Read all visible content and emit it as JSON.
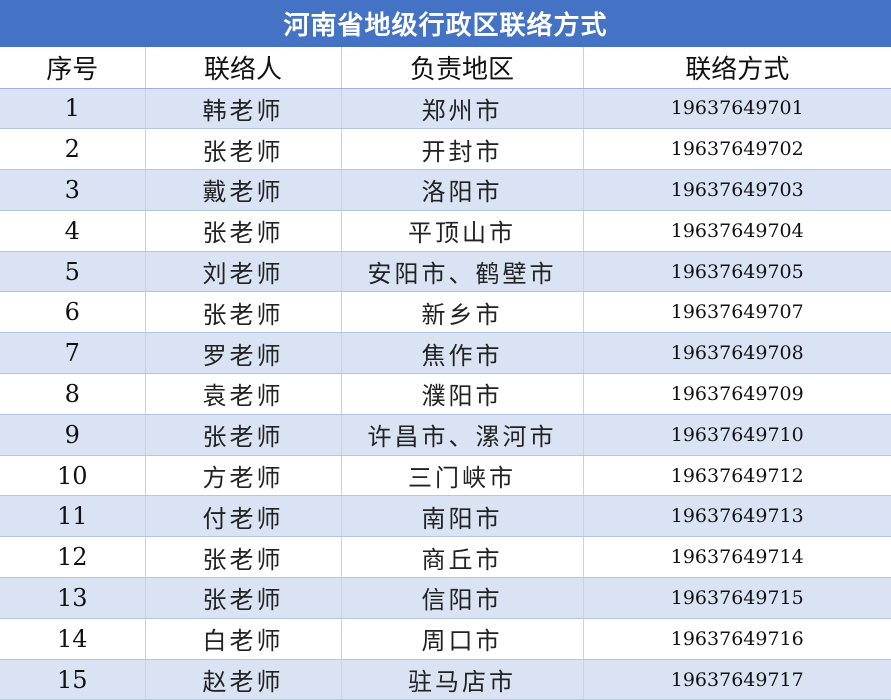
{
  "title": "河南省地级行政区联络方式",
  "columns": [
    "序号",
    "联络人",
    "负责地区",
    "联络方式"
  ],
  "rows": [
    {
      "seq": "1",
      "person": "韩老师",
      "region": "郑州市",
      "phone": "19637649701"
    },
    {
      "seq": "2",
      "person": "张老师",
      "region": "开封市",
      "phone": "19637649702"
    },
    {
      "seq": "3",
      "person": "戴老师",
      "region": "洛阳市",
      "phone": "19637649703"
    },
    {
      "seq": "4",
      "person": "张老师",
      "region": "平顶山市",
      "phone": "19637649704"
    },
    {
      "seq": "5",
      "person": "刘老师",
      "region": "安阳市、鹤壁市",
      "phone": "19637649705"
    },
    {
      "seq": "6",
      "person": "张老师",
      "region": "新乡市",
      "phone": "19637649707"
    },
    {
      "seq": "7",
      "person": "罗老师",
      "region": "焦作市",
      "phone": "19637649708"
    },
    {
      "seq": "8",
      "person": "袁老师",
      "region": "濮阳市",
      "phone": "19637649709"
    },
    {
      "seq": "9",
      "person": "张老师",
      "region": "许昌市、漯河市",
      "phone": "19637649710"
    },
    {
      "seq": "10",
      "person": "方老师",
      "region": "三门峡市",
      "phone": "19637649712"
    },
    {
      "seq": "11",
      "person": "付老师",
      "region": "南阳市",
      "phone": "19637649713"
    },
    {
      "seq": "12",
      "person": "张老师",
      "region": "商丘市",
      "phone": "19637649714"
    },
    {
      "seq": "13",
      "person": "张老师",
      "region": "信阳市",
      "phone": "19637649715"
    },
    {
      "seq": "14",
      "person": "白老师",
      "region": "周口市",
      "phone": "19637649716"
    },
    {
      "seq": "15",
      "person": "赵老师",
      "region": "驻马店市",
      "phone": "19637649717"
    }
  ],
  "colors": {
    "title_background": "#4472c4",
    "title_text": "#ffffff",
    "band_row": "#dae3f3",
    "plain_row": "#ffffff"
  }
}
